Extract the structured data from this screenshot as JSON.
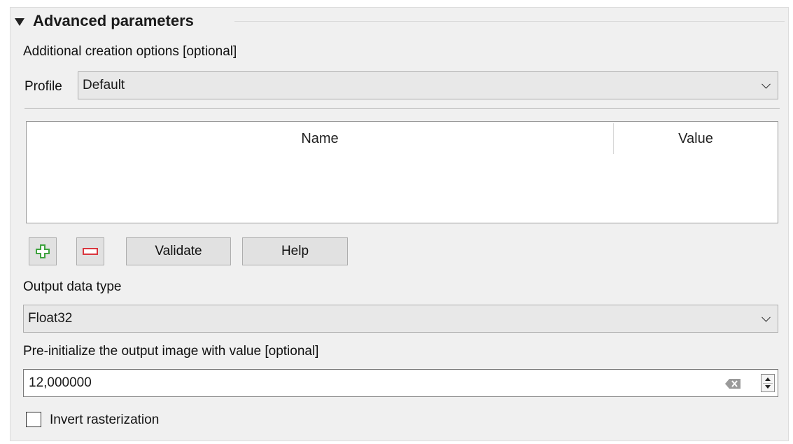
{
  "section": {
    "title": "Advanced parameters"
  },
  "creation_options": {
    "label": "Additional creation options [optional]",
    "profile_label": "Profile",
    "profile_value": "Default",
    "table_headers": [
      "Name",
      "Value"
    ],
    "validate_label": "Validate",
    "help_label": "Help"
  },
  "output_type": {
    "label": "Output data type",
    "value": "Float32"
  },
  "preinit": {
    "label": "Pre-initialize the output image with value [optional]",
    "value": "12,000000"
  },
  "invert": {
    "label": "Invert rasterization",
    "checked": false
  },
  "colors": {
    "add_green": "#3fa33f",
    "remove_red": "#d9363e"
  }
}
